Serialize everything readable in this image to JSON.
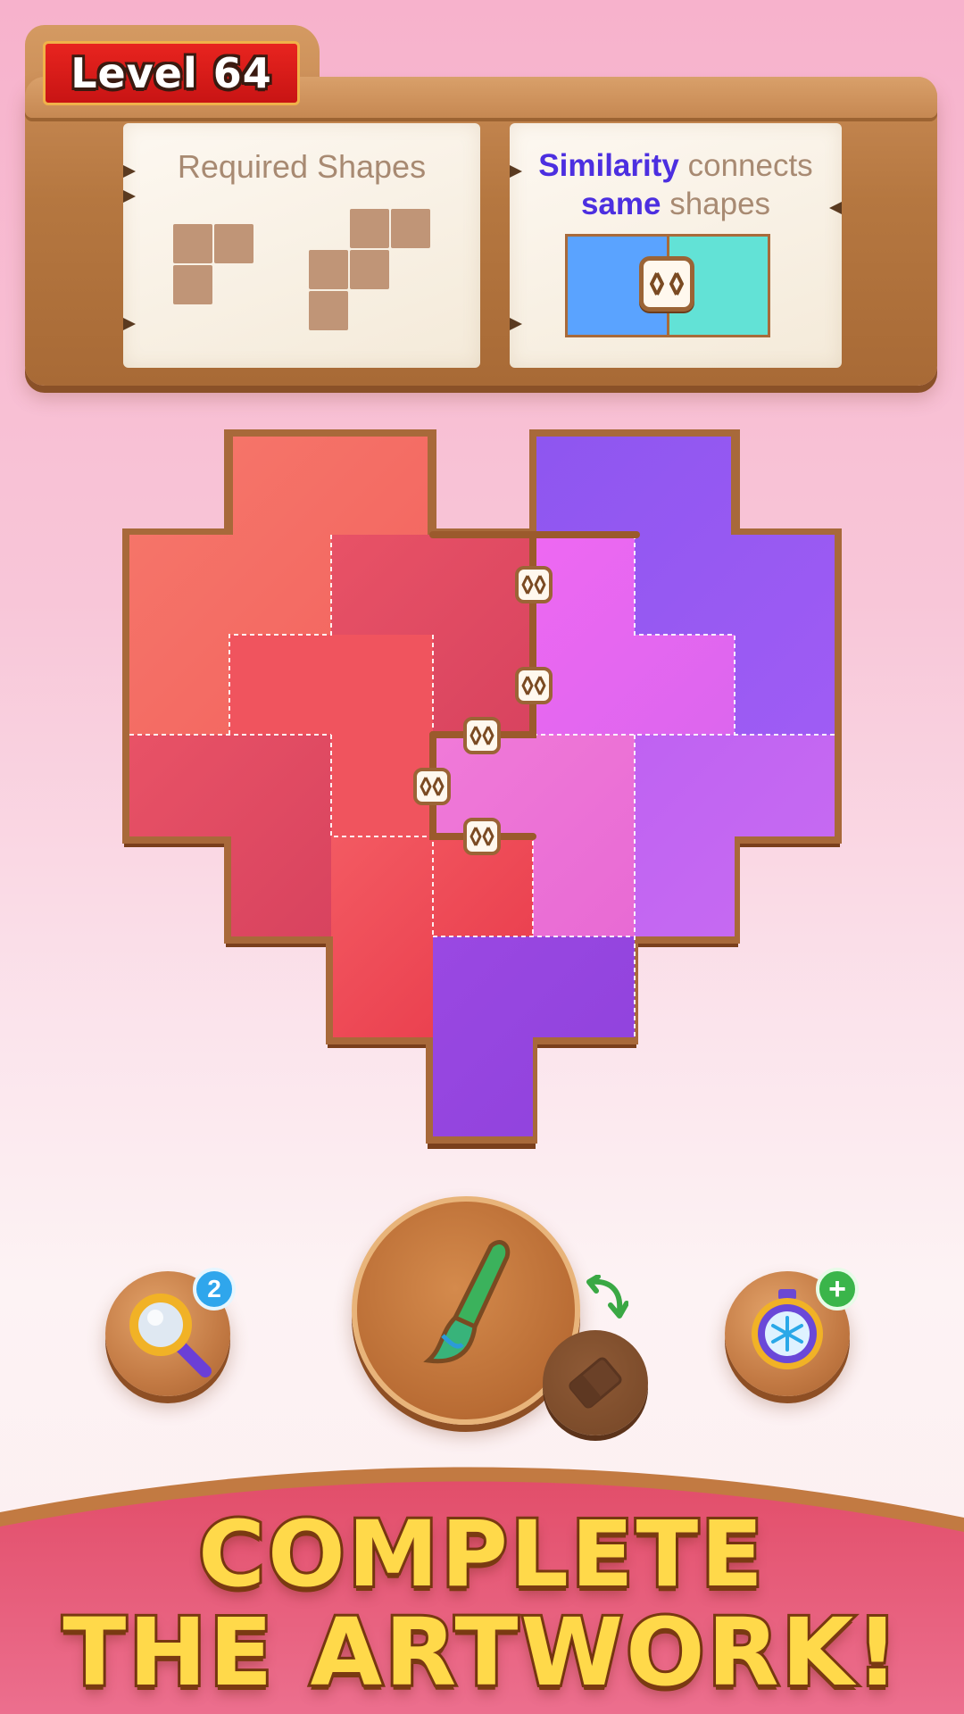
{
  "level": {
    "label": "Level 64"
  },
  "required_card": {
    "title": "Required Shapes"
  },
  "hint_card": {
    "word1": "Similarity",
    "word2": " connects",
    "word3": "same",
    "word4": " shapes"
  },
  "tools": {
    "hint_count": "2",
    "brush_icon": "paintbrush-icon",
    "eraser_icon": "eraser-icon",
    "freeze_plus": "+"
  },
  "banner": {
    "line1": "COMPLETE",
    "line2": "THE ARTWORK!"
  },
  "colors": {
    "wood": "#b57740",
    "level_red": "#d81c18",
    "accent_purple": "#4c2fe0",
    "coral": "#f46f69",
    "crimson": "#e24663",
    "magenta": "#e86cf0",
    "violet": "#9a5cf2",
    "banner_yellow": "#ffd94a"
  }
}
